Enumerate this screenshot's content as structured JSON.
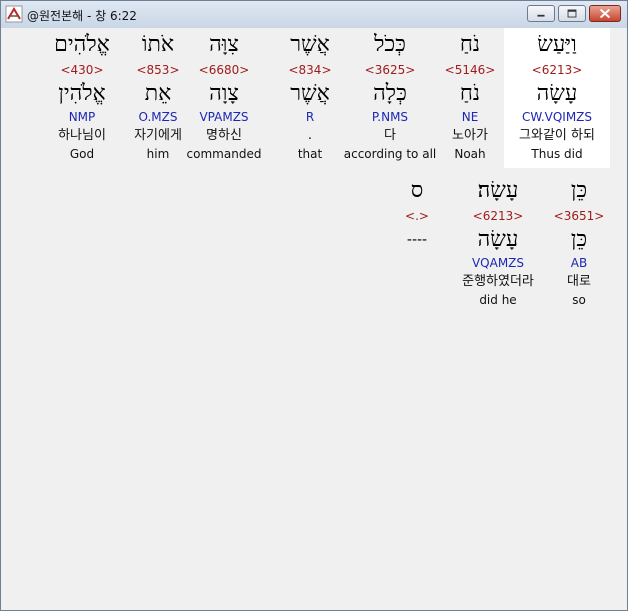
{
  "window": {
    "title": "@원전본해 - 창 6:22"
  },
  "words_row1": [
    {
      "heb": "וַיַּעַשׂ",
      "strong": "<6213>",
      "lemma": "עָשָׂה",
      "parse": "CW.VQIMZS",
      "korean": "그와같이 하되",
      "english": "Thus did",
      "selected": true
    },
    {
      "heb": "נֹחַ",
      "strong": "<5146>",
      "lemma": "נֹחַ",
      "parse": "NE",
      "korean": "노아가",
      "english": "Noah"
    },
    {
      "heb": "כְּכֹל",
      "strong": "<3625>",
      "lemma": "כְּלָה",
      "parse": "P.NMS",
      "korean": "다",
      "english": "according to all"
    },
    {
      "heb": "אֲשֶׁר",
      "strong": "<834>",
      "lemma": "אֲשֶׁר",
      "parse": "R",
      "korean": ".",
      "english": "that"
    },
    {
      "heb": "צִוָּה",
      "strong": "<6680>",
      "lemma": "צָוָה",
      "parse": "VPAMZS",
      "korean": "명하신",
      "english": "commanded"
    },
    {
      "heb": "אֹתוֹ",
      "strong": "<853>",
      "lemma": "אֵת",
      "parse": "O.MZS",
      "korean": "자기에게",
      "english": "him"
    },
    {
      "heb": "אֱלֹהִים",
      "strong": "<430>",
      "lemma": "אֱלֹהִין",
      "parse": "NMP",
      "korean": "하나님이",
      "english": "God"
    }
  ],
  "words_row2": [
    {
      "heb": "כֵּן",
      "strong": "<3651>",
      "lemma": "כֵּן",
      "parse": "AB",
      "korean": "대로",
      "english": "so"
    },
    {
      "heb": "עָשָׂה׃",
      "strong": "<6213>",
      "lemma": "עָשָׂה",
      "parse": "VQAMZS",
      "korean": "준행하였더라",
      "english": "did he"
    },
    {
      "heb": "ס",
      "strong": "<.>",
      "lemma": "----",
      "parse": "",
      "korean": "",
      "english": ""
    }
  ]
}
